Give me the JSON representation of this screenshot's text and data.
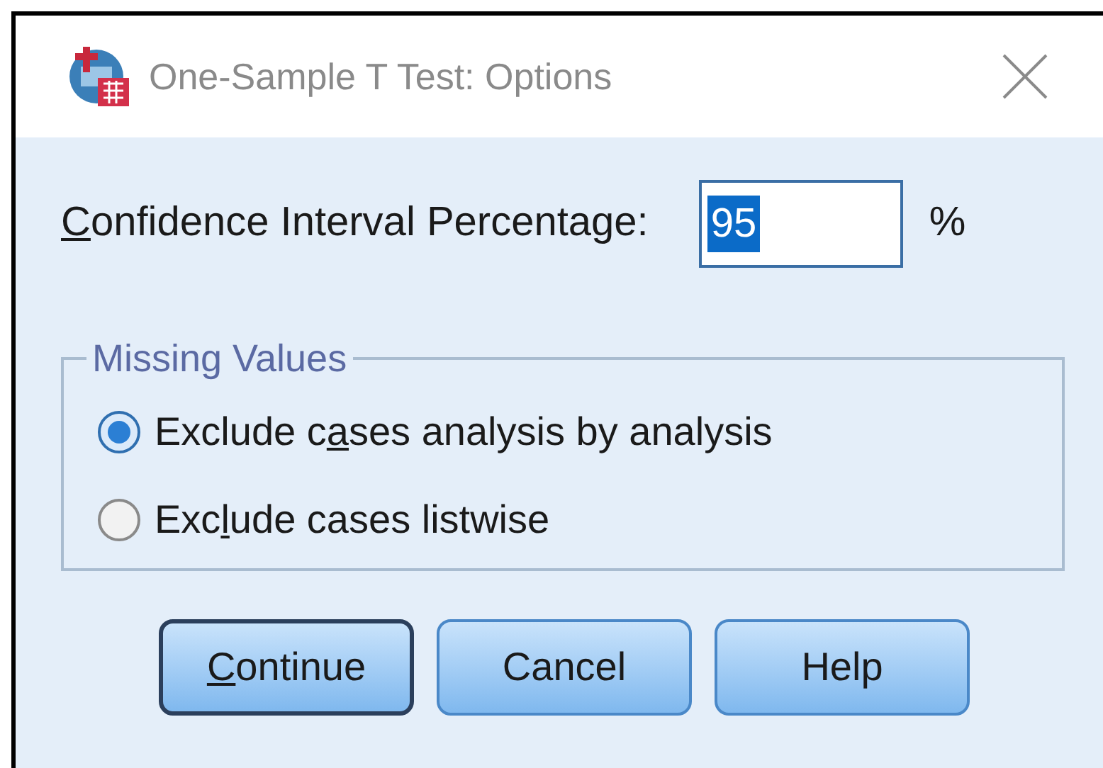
{
  "window": {
    "title": "One-Sample T Test: Options"
  },
  "confidence": {
    "label": {
      "underlined": "C",
      "after": "onfidence Interval Percentage:"
    },
    "value": "95",
    "unit": "%"
  },
  "missing_values": {
    "title": "Missing Values",
    "options": [
      {
        "label": {
          "before": "Exclude c",
          "underlined": "a",
          "after": "ses analysis by analysis"
        },
        "selected": true
      },
      {
        "label": {
          "before": "Exc",
          "underlined": "l",
          "after": "ude cases listwise"
        },
        "selected": false
      }
    ]
  },
  "buttons": [
    {
      "label": {
        "underlined": "C",
        "after": "ontinue"
      },
      "default": true
    },
    {
      "label": {
        "before": "Cancel"
      },
      "default": false
    },
    {
      "label": {
        "before": "Help"
      },
      "default": false
    }
  ]
}
